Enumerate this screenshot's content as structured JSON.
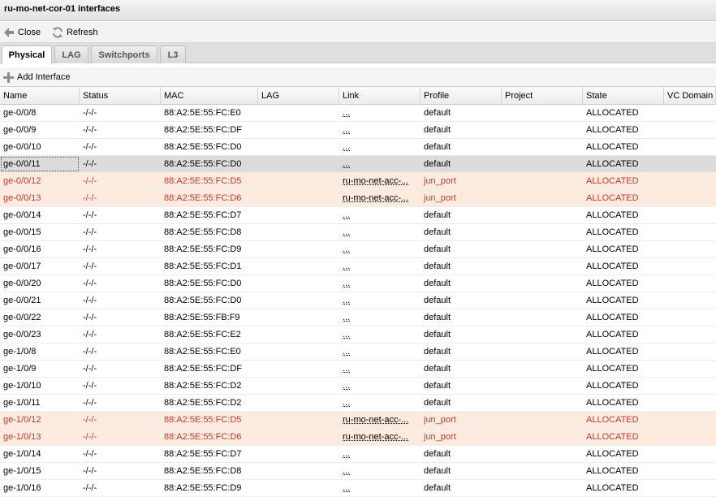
{
  "window": {
    "title": "ru-mo-net-cor-01 interfaces"
  },
  "toolbar": {
    "close_label": "Close",
    "refresh_label": "Refresh"
  },
  "tabs": [
    {
      "label": "Physical",
      "active": true
    },
    {
      "label": "LAG",
      "active": false
    },
    {
      "label": "Switchports",
      "active": false
    },
    {
      "label": "L3",
      "active": false
    }
  ],
  "subtoolbar": {
    "add_label": "Add Interface"
  },
  "columns": [
    "Name",
    "Status",
    "MAC",
    "LAG",
    "Link",
    "Profile",
    "Project",
    "State",
    "VC Domain"
  ],
  "rows": [
    {
      "name": "ge-0/0/8",
      "status": "-/-/-",
      "mac": "88:A2:5E:55:FC:E0",
      "lag": "",
      "link": "...",
      "profile": "default",
      "project": "",
      "state": "ALLOCATED",
      "vc": "",
      "kind": "normal"
    },
    {
      "name": "ge-0/0/9",
      "status": "-/-/-",
      "mac": "88:A2:5E:55:FC:DF",
      "lag": "",
      "link": "...",
      "profile": "default",
      "project": "",
      "state": "ALLOCATED",
      "vc": "",
      "kind": "normal"
    },
    {
      "name": "ge-0/0/10",
      "status": "-/-/-",
      "mac": "88:A2:5E:55:FC:D0",
      "lag": "",
      "link": "...",
      "profile": "default",
      "project": "",
      "state": "ALLOCATED",
      "vc": "",
      "kind": "normal"
    },
    {
      "name": "ge-0/0/11",
      "status": "-/-/-",
      "mac": "88:A2:5E:55:FC:D0",
      "lag": "",
      "link": "...",
      "profile": "default",
      "project": "",
      "state": "ALLOCATED",
      "vc": "",
      "kind": "selected"
    },
    {
      "name": "ge-0/0/12",
      "status": "-/-/-",
      "mac": "88:A2:5E:55:FC:D5",
      "lag": "",
      "link": "ru-mo-net-acc-...",
      "profile": "jun_port",
      "project": "",
      "state": "ALLOCATED",
      "vc": "",
      "kind": "alloc-port"
    },
    {
      "name": "ge-0/0/13",
      "status": "-/-/-",
      "mac": "88:A2:5E:55:FC:D6",
      "lag": "",
      "link": "ru-mo-net-acc-...",
      "profile": "jun_port",
      "project": "",
      "state": "ALLOCATED",
      "vc": "",
      "kind": "alloc-port"
    },
    {
      "name": "ge-0/0/14",
      "status": "-/-/-",
      "mac": "88:A2:5E:55:FC:D7",
      "lag": "",
      "link": "...",
      "profile": "default",
      "project": "",
      "state": "ALLOCATED",
      "vc": "",
      "kind": "normal"
    },
    {
      "name": "ge-0/0/15",
      "status": "-/-/-",
      "mac": "88:A2:5E:55:FC:D8",
      "lag": "",
      "link": "...",
      "profile": "default",
      "project": "",
      "state": "ALLOCATED",
      "vc": "",
      "kind": "normal"
    },
    {
      "name": "ge-0/0/16",
      "status": "-/-/-",
      "mac": "88:A2:5E:55:FC:D9",
      "lag": "",
      "link": "...",
      "profile": "default",
      "project": "",
      "state": "ALLOCATED",
      "vc": "",
      "kind": "normal"
    },
    {
      "name": "ge-0/0/17",
      "status": "-/-/-",
      "mac": "88:A2:5E:55:FC:D1",
      "lag": "",
      "link": "...",
      "profile": "default",
      "project": "",
      "state": "ALLOCATED",
      "vc": "",
      "kind": "normal"
    },
    {
      "name": "ge-0/0/20",
      "status": "-/-/-",
      "mac": "88:A2:5E:55:FC:D0",
      "lag": "",
      "link": "...",
      "profile": "default",
      "project": "",
      "state": "ALLOCATED",
      "vc": "",
      "kind": "normal"
    },
    {
      "name": "ge-0/0/21",
      "status": "-/-/-",
      "mac": "88:A2:5E:55:FC:D0",
      "lag": "",
      "link": "...",
      "profile": "default",
      "project": "",
      "state": "ALLOCATED",
      "vc": "",
      "kind": "normal"
    },
    {
      "name": "ge-0/0/22",
      "status": "-/-/-",
      "mac": "88:A2:5E:55:FB:F9",
      "lag": "",
      "link": "...",
      "profile": "default",
      "project": "",
      "state": "ALLOCATED",
      "vc": "",
      "kind": "normal"
    },
    {
      "name": "ge-0/0/23",
      "status": "-/-/-",
      "mac": "88:A2:5E:55:FC:E2",
      "lag": "",
      "link": "...",
      "profile": "default",
      "project": "",
      "state": "ALLOCATED",
      "vc": "",
      "kind": "normal"
    },
    {
      "name": "ge-1/0/8",
      "status": "-/-/-",
      "mac": "88:A2:5E:55:FC:E0",
      "lag": "",
      "link": "...",
      "profile": "default",
      "project": "",
      "state": "ALLOCATED",
      "vc": "",
      "kind": "normal"
    },
    {
      "name": "ge-1/0/9",
      "status": "-/-/-",
      "mac": "88:A2:5E:55:FC:DF",
      "lag": "",
      "link": "...",
      "profile": "default",
      "project": "",
      "state": "ALLOCATED",
      "vc": "",
      "kind": "normal"
    },
    {
      "name": "ge-1/0/10",
      "status": "-/-/-",
      "mac": "88:A2:5E:55:FC:D2",
      "lag": "",
      "link": "...",
      "profile": "default",
      "project": "",
      "state": "ALLOCATED",
      "vc": "",
      "kind": "normal"
    },
    {
      "name": "ge-1/0/11",
      "status": "-/-/-",
      "mac": "88:A2:5E:55:FC:D2",
      "lag": "",
      "link": "...",
      "profile": "default",
      "project": "",
      "state": "ALLOCATED",
      "vc": "",
      "kind": "normal"
    },
    {
      "name": "ge-1/0/12",
      "status": "-/-/-",
      "mac": "88:A2:5E:55:FC:D5",
      "lag": "",
      "link": "ru-mo-net-acc-...",
      "profile": "jun_port",
      "project": "",
      "state": "ALLOCATED",
      "vc": "",
      "kind": "alloc-port"
    },
    {
      "name": "ge-1/0/13",
      "status": "-/-/-",
      "mac": "88:A2:5E:55:FC:D6",
      "lag": "",
      "link": "ru-mo-net-acc-...",
      "profile": "jun_port",
      "project": "",
      "state": "ALLOCATED",
      "vc": "",
      "kind": "alloc-port"
    },
    {
      "name": "ge-1/0/14",
      "status": "-/-/-",
      "mac": "88:A2:5E:55:FC:D7",
      "lag": "",
      "link": "...",
      "profile": "default",
      "project": "",
      "state": "ALLOCATED",
      "vc": "",
      "kind": "normal"
    },
    {
      "name": "ge-1/0/15",
      "status": "-/-/-",
      "mac": "88:A2:5E:55:FC:D8",
      "lag": "",
      "link": "...",
      "profile": "default",
      "project": "",
      "state": "ALLOCATED",
      "vc": "",
      "kind": "normal"
    },
    {
      "name": "ge-1/0/16",
      "status": "-/-/-",
      "mac": "88:A2:5E:55:FC:D9",
      "lag": "",
      "link": "...",
      "profile": "default",
      "project": "",
      "state": "ALLOCATED",
      "vc": "",
      "kind": "normal"
    }
  ],
  "icons": {
    "close": "arrow-left-icon",
    "refresh": "refresh-icon",
    "add": "plus-icon"
  }
}
